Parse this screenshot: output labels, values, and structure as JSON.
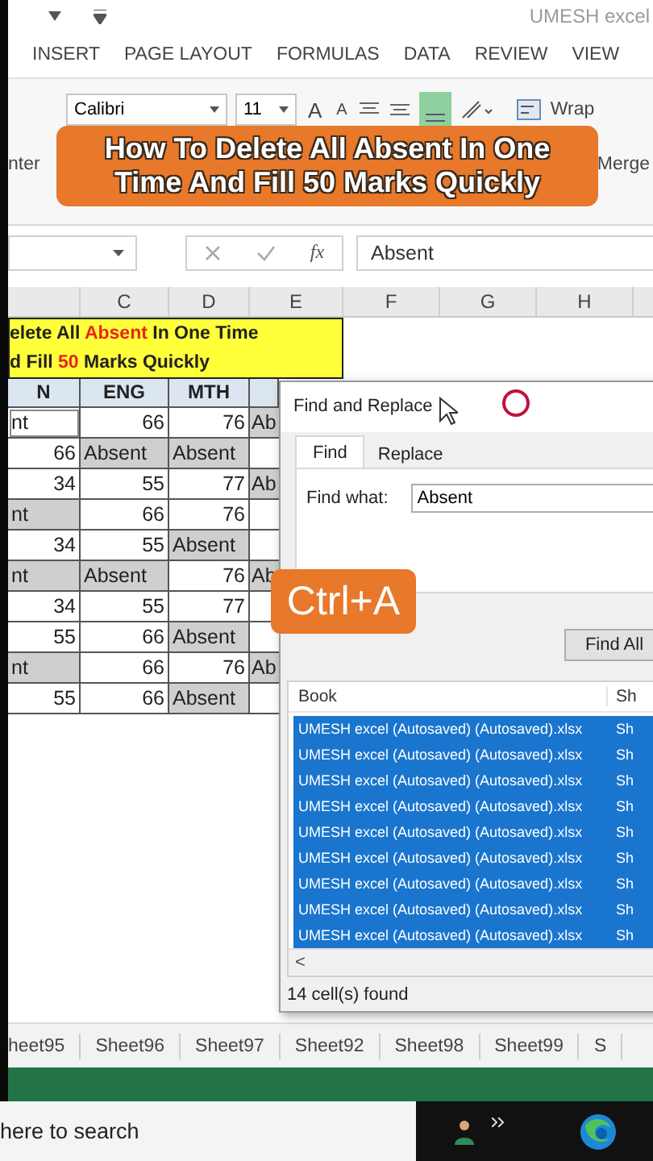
{
  "title_bar": {
    "title": "UMESH excel"
  },
  "ribbon_tabs": [
    {
      "label": "INSERT",
      "selected": false
    },
    {
      "label": "PAGE LAYOUT",
      "selected": false
    },
    {
      "label": "FORMULAS",
      "selected": false
    },
    {
      "label": "DATA",
      "selected": false
    },
    {
      "label": "REVIEW",
      "selected": false
    },
    {
      "label": "VIEW",
      "selected": false
    }
  ],
  "ribbon": {
    "font_name": "Calibri",
    "font_size": "11",
    "grow_font": "A",
    "shrink_font": "A",
    "wrap_text": "Wrap",
    "merge": "Merge",
    "format_painter": "nter"
  },
  "caption": [
    "How To Delete All Absent In One",
    "Time And Fill 50 Marks Quickly"
  ],
  "formula_bar": {
    "function_label": "fx",
    "value": "Absent"
  },
  "columns": [
    "C",
    "D",
    "E",
    "F",
    "G",
    "H"
  ],
  "sheet_title": [
    [
      {
        "text": "elete All ",
        "highlight": false
      },
      {
        "text": "Absent",
        "highlight": true
      },
      {
        "text": " In One Time",
        "highlight": false
      }
    ],
    [
      {
        "text": "d Fill ",
        "highlight": false
      },
      {
        "text": "50",
        "highlight": true
      },
      {
        "text": " Marks Quickly",
        "highlight": false
      }
    ]
  ],
  "header_row": [
    "N",
    "ENG",
    "MTH"
  ],
  "rows": [
    {
      "cells": [
        {
          "text": "nt",
          "selected": true,
          "active": true
        },
        {
          "text": "66",
          "selected": false,
          "active": false
        },
        {
          "text": "76",
          "selected": false,
          "active": false
        },
        {
          "text": "Ab",
          "selected": true,
          "active": false
        }
      ]
    },
    {
      "cells": [
        {
          "text": "66",
          "selected": false,
          "active": false
        },
        {
          "text": "Absent",
          "selected": true,
          "active": false
        },
        {
          "text": "Absent",
          "selected": true,
          "active": false
        },
        {
          "selected": false,
          "active": false
        }
      ]
    },
    {
      "cells": [
        {
          "text": "34",
          "selected": false,
          "active": false
        },
        {
          "text": "55",
          "selected": false,
          "active": false
        },
        {
          "text": "77",
          "selected": false,
          "active": false
        },
        {
          "text": "Ab",
          "selected": true,
          "active": false
        }
      ]
    },
    {
      "cells": [
        {
          "text": "nt",
          "selected": true,
          "active": false
        },
        {
          "text": "66",
          "selected": false,
          "active": false
        },
        {
          "text": "76",
          "selected": false,
          "active": false
        },
        {
          "selected": false,
          "active": false
        }
      ]
    },
    {
      "cells": [
        {
          "text": "34",
          "selected": false,
          "active": false
        },
        {
          "text": "55",
          "selected": false,
          "active": false
        },
        {
          "text": "Absent",
          "selected": true,
          "active": false
        },
        {
          "selected": false,
          "active": false
        }
      ]
    },
    {
      "cells": [
        {
          "text": "nt",
          "selected": true,
          "active": false
        },
        {
          "text": "Absent",
          "selected": true,
          "active": false
        },
        {
          "text": "76",
          "selected": false,
          "active": false
        },
        {
          "text": "Ab",
          "selected": true,
          "active": false
        }
      ]
    },
    {
      "cells": [
        {
          "text": "34",
          "selected": false,
          "active": false
        },
        {
          "text": "55",
          "selected": false,
          "active": false
        },
        {
          "text": "77",
          "selected": false,
          "active": false
        },
        {
          "selected": false,
          "active": false
        }
      ]
    },
    {
      "cells": [
        {
          "text": "55",
          "selected": false,
          "active": false
        },
        {
          "text": "66",
          "selected": false,
          "active": false
        },
        {
          "text": "Absent",
          "selected": true,
          "active": false
        },
        {
          "selected": false,
          "active": false
        }
      ]
    },
    {
      "cells": [
        {
          "text": "nt",
          "selected": true,
          "active": false
        },
        {
          "text": "66",
          "selected": false,
          "active": false
        },
        {
          "text": "76",
          "selected": false,
          "active": false
        },
        {
          "text": "Ab",
          "selected": true,
          "active": false
        }
      ]
    },
    {
      "cells": [
        {
          "text": "55",
          "selected": false,
          "active": false
        },
        {
          "text": "66",
          "selected": false,
          "active": false
        },
        {
          "text": "Absent",
          "selected": true,
          "active": false
        },
        {
          "selected": false,
          "active": false
        }
      ]
    }
  ],
  "dialog": {
    "title": "Find and Replace",
    "tabs": [
      {
        "label": "Find",
        "selected": true
      },
      {
        "label": "Replace",
        "selected": false
      }
    ],
    "find_what_label": "Find what:",
    "find_what": "Absent",
    "find_all_button": "Find All",
    "result_columns": [
      "Book",
      "Sh"
    ],
    "results": [
      {
        "book": "UMESH excel (Autosaved) (Autosaved).xlsx",
        "sheet": "Sh",
        "selected": true
      },
      {
        "book": "UMESH excel (Autosaved) (Autosaved).xlsx",
        "sheet": "Sh",
        "selected": true
      },
      {
        "book": "UMESH excel (Autosaved) (Autosaved).xlsx",
        "sheet": "Sh",
        "selected": true
      },
      {
        "book": "UMESH excel (Autosaved) (Autosaved).xlsx",
        "sheet": "Sh",
        "selected": true
      },
      {
        "book": "UMESH excel (Autosaved) (Autosaved).xlsx",
        "sheet": "Sh",
        "selected": true
      },
      {
        "book": "UMESH excel (Autosaved) (Autosaved).xlsx",
        "sheet": "Sh",
        "selected": true
      },
      {
        "book": "UMESH excel (Autosaved) (Autosaved).xlsx",
        "sheet": "Sh",
        "selected": true
      },
      {
        "book": "UMESH excel (Autosaved) (Autosaved).xlsx",
        "sheet": "Sh",
        "selected": true
      },
      {
        "book": "UMESH excel (Autosaved) (Autosaved).xlsx",
        "sheet": "Sh",
        "selected": true
      }
    ],
    "scroll_left": "<",
    "status": "14 cell(s) found"
  },
  "shortcut_overlay": "Ctrl+A",
  "sheet_tabs": [
    {
      "label": "heet95",
      "selected": false
    },
    {
      "label": "Sheet96",
      "selected": false
    },
    {
      "label": "Sheet97",
      "selected": false
    },
    {
      "label": "Sheet92",
      "selected": false
    },
    {
      "label": "Sheet98",
      "selected": false
    },
    {
      "label": "Sheet99",
      "selected": false
    },
    {
      "label": "S",
      "selected": false
    }
  ],
  "taskbar": {
    "search": {
      "placeholder": "here to search"
    }
  }
}
